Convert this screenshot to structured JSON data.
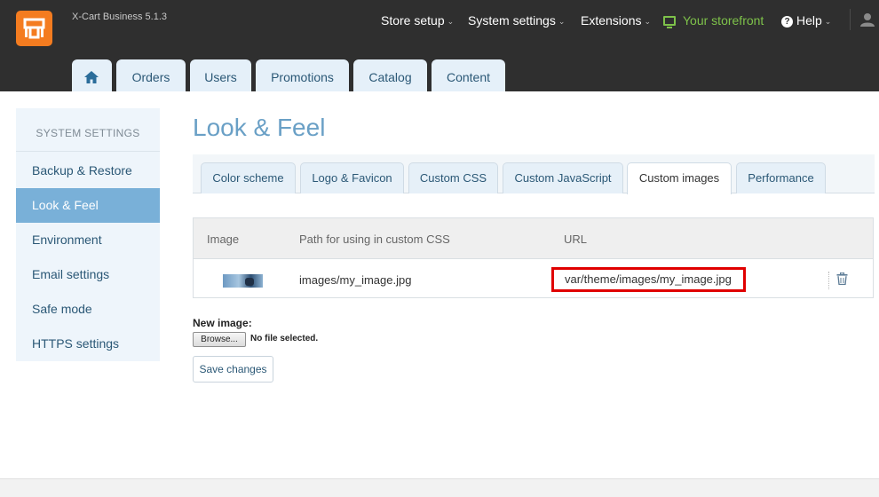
{
  "header": {
    "brand": "X-Cart Business 5.1.3",
    "nav": {
      "store_setup": "Store setup",
      "system_settings": "System settings",
      "extensions": "Extensions",
      "storefront": "Your storefront",
      "help": "Help"
    },
    "caret": "⌄",
    "main_tabs": {
      "orders": "Orders",
      "users": "Users",
      "promotions": "Promotions",
      "catalog": "Catalog",
      "content": "Content"
    }
  },
  "sidebar": {
    "title": "SYSTEM SETTINGS",
    "items": [
      {
        "label": "Backup & Restore"
      },
      {
        "label": "Look & Feel",
        "active": true
      },
      {
        "label": "Environment"
      },
      {
        "label": "Email settings"
      },
      {
        "label": "Safe mode"
      },
      {
        "label": "HTTPS settings"
      }
    ]
  },
  "page": {
    "title": "Look & Feel",
    "tabs": [
      {
        "label": "Color scheme"
      },
      {
        "label": "Logo & Favicon"
      },
      {
        "label": "Custom CSS"
      },
      {
        "label": "Custom JavaScript"
      },
      {
        "label": "Custom images",
        "active": true
      },
      {
        "label": "Performance"
      }
    ]
  },
  "table": {
    "columns": {
      "image": "Image",
      "path": "Path for using in custom CSS",
      "url": "URL"
    },
    "rows": [
      {
        "path": "images/my_image.jpg",
        "url": "var/theme/images/my_image.jpg"
      }
    ]
  },
  "upload": {
    "label": "New image:",
    "browse": "Browse...",
    "status": "No file selected."
  },
  "actions": {
    "save": "Save changes"
  },
  "colors": {
    "header_bg": "#2f2f2f",
    "logo": "#f47c20",
    "accent": "#79b0d8",
    "storefront": "#7ec24a",
    "highlight": "#e00000"
  },
  "icons": [
    "xcart-logo-icon",
    "home-icon",
    "monitor-icon",
    "help-icon",
    "user-icon",
    "trash-icon"
  ]
}
